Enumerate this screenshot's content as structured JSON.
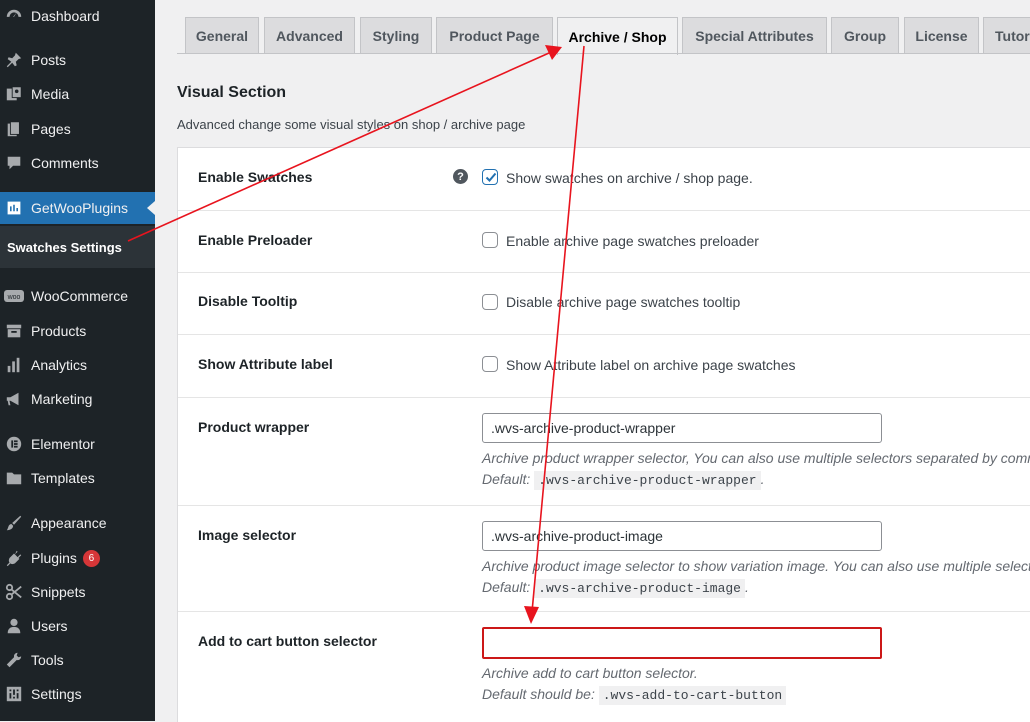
{
  "sidebar": {
    "items": [
      {
        "label": "Dashboard",
        "icon": "dashboard-icon"
      },
      {
        "label": "Posts",
        "icon": "pin-icon"
      },
      {
        "label": "Media",
        "icon": "media-icon"
      },
      {
        "label": "Pages",
        "icon": "pages-icon"
      },
      {
        "label": "Comments",
        "icon": "comment-icon"
      },
      {
        "label": "GetWooPlugins",
        "icon": "plugin-logo-icon"
      },
      {
        "label": "WooCommerce",
        "icon": "woo-icon"
      },
      {
        "label": "Products",
        "icon": "archive-icon"
      },
      {
        "label": "Analytics",
        "icon": "bar-chart-icon"
      },
      {
        "label": "Marketing",
        "icon": "megaphone-icon"
      },
      {
        "label": "Elementor",
        "icon": "elementor-icon"
      },
      {
        "label": "Templates",
        "icon": "folder-icon"
      },
      {
        "label": "Appearance",
        "icon": "brush-icon"
      },
      {
        "label": "Plugins",
        "icon": "plug-icon"
      },
      {
        "label": "Snippets",
        "icon": "scissors-icon"
      },
      {
        "label": "Users",
        "icon": "user-icon"
      },
      {
        "label": "Tools",
        "icon": "wrench-icon"
      },
      {
        "label": "Settings",
        "icon": "settings-icon"
      }
    ],
    "submenu_label": "Swatches Settings",
    "plugins_badge": "6"
  },
  "tabs": [
    "General",
    "Advanced",
    "Styling",
    "Product Page",
    "Archive / Shop",
    "Special Attributes",
    "Group",
    "License",
    "Tutor"
  ],
  "active_tab": "Archive / Shop",
  "section": {
    "title": "Visual Section",
    "description": "Advanced change some visual styles on shop / archive page"
  },
  "rows": {
    "enable_swatches": {
      "label": "Enable Swatches",
      "help": "?",
      "checkbox_label": "Show swatches on archive / shop page.",
      "checked": true
    },
    "enable_preloader": {
      "label": "Enable Preloader",
      "checkbox_label": "Enable archive page swatches preloader",
      "checked": false
    },
    "disable_tooltip": {
      "label": "Disable Tooltip",
      "checkbox_label": "Disable archive page swatches tooltip",
      "checked": false
    },
    "show_attribute_label": {
      "label": "Show Attribute label",
      "checkbox_label": "Show Attribute label on archive page swatches",
      "checked": false
    },
    "product_wrapper": {
      "label": "Product wrapper",
      "value": ".wvs-archive-product-wrapper",
      "description": "Archive product wrapper selector, You can also use multiple selectors separated by comma",
      "default_prefix": "Default:",
      "default_value": ".wvs-archive-product-wrapper",
      "default_suffix": "."
    },
    "image_selector": {
      "label": "Image selector",
      "value": ".wvs-archive-product-image",
      "description": "Archive product image selector to show variation image. You can also use multiple selectors",
      "default_prefix": "Default:",
      "default_value": ".wvs-archive-product-image",
      "default_suffix": "."
    },
    "add_to_cart": {
      "label": "Add to cart button selector",
      "value": "",
      "description": "Archive add to cart button selector.",
      "default_prefix": "Default should be:",
      "default_value": ".wvs-add-to-cart-button"
    }
  },
  "colors": {
    "sidebar_bg": "#1d2327",
    "active_menu": "#2271b1",
    "annotation_arrow": "#e8141e",
    "highlight_border": "#cc1818",
    "badge": "#d63638"
  }
}
